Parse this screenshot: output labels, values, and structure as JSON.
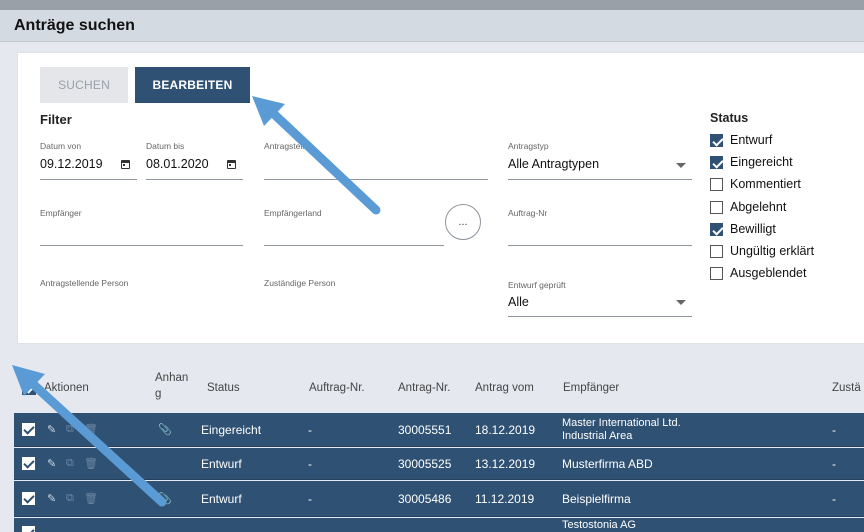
{
  "page": {
    "title": "Anträge suchen"
  },
  "toolbar": {
    "search_label": "SUCHEN",
    "edit_label": "BEARBEITEN"
  },
  "filter": {
    "title": "Filter",
    "date_from": {
      "label": "Datum von",
      "value": "09.12.2019"
    },
    "date_to": {
      "label": "Datum bis",
      "value": "08.01.2020"
    },
    "applicant": {
      "label": "Antragsteller",
      "value": ""
    },
    "request_type": {
      "label": "Antragstyp",
      "value": "Alle Antragtypen"
    },
    "recipient": {
      "label": "Empfänger",
      "value": ""
    },
    "recipient_country": {
      "label": "Empfängerland",
      "value": ""
    },
    "more_button": "...",
    "order_no": {
      "label": "Auftrag-Nr",
      "value": ""
    },
    "applying_person": {
      "label": "Antragstellende Person",
      "value": ""
    },
    "responsible_person": {
      "label": "Zuständige Person",
      "value": ""
    },
    "draft_checked": {
      "label": "Entwurf geprüft",
      "value": "Alle"
    }
  },
  "status": {
    "title": "Status",
    "options": [
      {
        "label": "Entwurf",
        "checked": true
      },
      {
        "label": "Eingereicht",
        "checked": true
      },
      {
        "label": "Kommentiert",
        "checked": false
      },
      {
        "label": "Abgelehnt",
        "checked": false
      },
      {
        "label": "Bewilligt",
        "checked": true
      },
      {
        "label": "Ungültig erklärt",
        "checked": false
      },
      {
        "label": "Ausgeblendet",
        "checked": false
      }
    ]
  },
  "table": {
    "columns": {
      "actions": "Aktionen",
      "attachment_1": "Anhan",
      "attachment_2": "g",
      "status": "Status",
      "order_no": "Auftrag-Nr.",
      "request_no": "Antrag-Nr.",
      "request_date": "Antrag vom",
      "recipient": "Empfänger",
      "responsible": "Zustä"
    },
    "rows": [
      {
        "status": "Eingereicht",
        "order_no": "-",
        "request_no": "30005551",
        "date": "18.12.2019",
        "recipient_1": "Master International Ltd.",
        "recipient_2": "Industrial Area",
        "responsible": "-",
        "attachment": true
      },
      {
        "status": "Entwurf",
        "order_no": "-",
        "request_no": "30005525",
        "date": "13.12.2019",
        "recipient_1": "Musterfirma ABD",
        "recipient_2": "",
        "responsible": "-",
        "attachment": false
      },
      {
        "status": "Entwurf",
        "order_no": "-",
        "request_no": "30005486",
        "date": "11.12.2019",
        "recipient_1": "Beispielfirma",
        "recipient_2": "",
        "responsible": "-",
        "attachment": true
      },
      {
        "status": "",
        "order_no": "",
        "request_no": "",
        "date": "",
        "recipient_1": "Testostonia AG",
        "recipient_2": "",
        "responsible": "",
        "attachment": false
      }
    ]
  },
  "colors": {
    "primary": "#2f5173",
    "header_bg": "#d4dae2",
    "arrow": "#5b9bd5"
  },
  "icons": [
    "calendar-icon",
    "dropdown-caret-icon",
    "checkbox-icon",
    "edit-icon",
    "copy-icon",
    "delete-icon",
    "paperclip-icon",
    "pointer-arrow"
  ]
}
